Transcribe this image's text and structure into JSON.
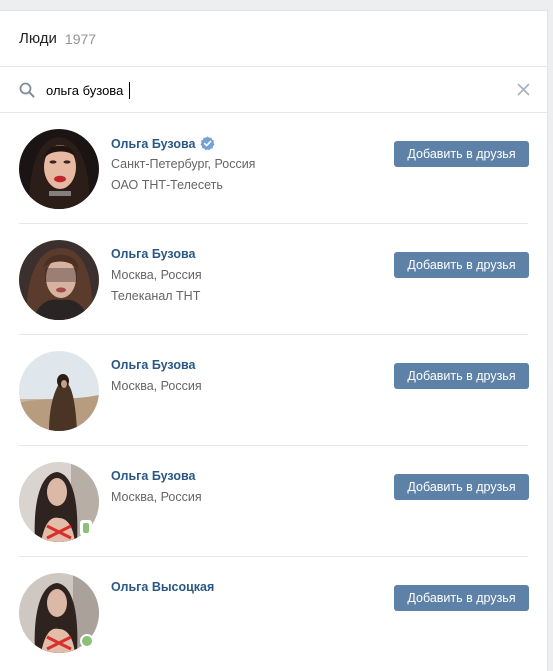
{
  "header": {
    "title": "Люди",
    "count": "1977"
  },
  "search": {
    "query": "ольга бузова",
    "icon": "search-icon",
    "clear_icon": "close-icon"
  },
  "colors": {
    "link": "#2a5885",
    "button": "#5e81a8",
    "online": "#8ac176"
  },
  "people": [
    {
      "name": "Ольга Бузова",
      "verified": true,
      "line1": "Санкт-Петербург, Россия",
      "line2": "ОАО ТНТ-Телесеть",
      "button": "Добавить в друзья",
      "status": "none"
    },
    {
      "name": "Ольга Бузова",
      "verified": false,
      "line1": "Москва, Россия",
      "line2": "Телеканал ТНТ",
      "button": "Добавить в друзья",
      "status": "none"
    },
    {
      "name": "Ольга Бузова",
      "verified": false,
      "line1": "Москва, Россия",
      "line2": "",
      "button": "Добавить в друзья",
      "status": "none"
    },
    {
      "name": "Ольга Бузова",
      "verified": false,
      "line1": "Москва, Россия",
      "line2": "",
      "button": "Добавить в друзья",
      "status": "mobile"
    },
    {
      "name": "Ольга Высоцкая",
      "verified": false,
      "line1": "",
      "line2": "",
      "button": "Добавить в друзья",
      "status": "online"
    }
  ]
}
